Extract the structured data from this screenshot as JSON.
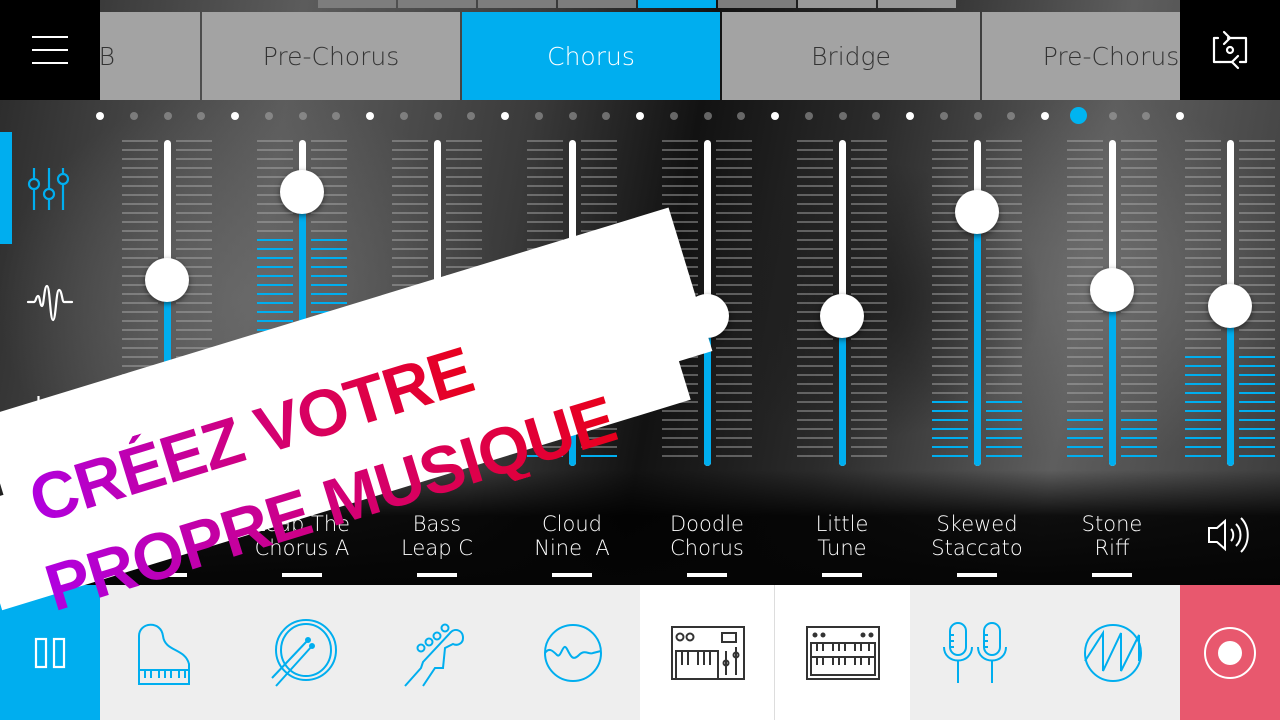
{
  "header": {
    "menu_icon": "hamburger-menu-icon",
    "loop_icon": "loop-swap-icon",
    "mini_segments": {
      "count": 8,
      "active_index": 4
    },
    "sections": [
      {
        "label": "Verse B",
        "active": false
      },
      {
        "label": "Pre-Chorus",
        "active": false
      },
      {
        "label": "Chorus",
        "active": true
      },
      {
        "label": "Bridge",
        "active": false
      },
      {
        "label": "Pre-Chorus",
        "active": false
      }
    ]
  },
  "sidebar": {
    "items": [
      {
        "icon": "mixer-sliders-icon",
        "active": true
      },
      {
        "icon": "waveform-icon",
        "active": false
      },
      {
        "icon": "music-notes-icon",
        "active": false
      }
    ]
  },
  "beat_dots": {
    "count": 33,
    "major_every": 4,
    "current_index": 29
  },
  "mixer": {
    "channels": [
      {
        "label_line1": "",
        "label_line2": "",
        "fader": 0.57,
        "meter_level": 0.0
      },
      {
        "label_line1": "Leap The",
        "label_line2": "Chorus A",
        "fader": 0.84,
        "meter_level": 0.72
      },
      {
        "label_line1": "Bass",
        "label_line2": "Leap C",
        "fader": 0.47,
        "meter_level": 0.0
      },
      {
        "label_line1": "Cloud",
        "label_line2": "Nine  A",
        "fader": 0.51,
        "meter_level": 0.06
      },
      {
        "label_line1": "Doodle",
        "label_line2": "Chorus",
        "fader": 0.46,
        "meter_level": 0.0
      },
      {
        "label_line1": "Little",
        "label_line2": "Tune",
        "fader": 0.46,
        "meter_level": 0.0
      },
      {
        "label_line1": "Skewed",
        "label_line2": "Staccato",
        "fader": 0.78,
        "meter_level": 0.2
      },
      {
        "label_line1": "Stone",
        "label_line2": "Riff",
        "fader": 0.54,
        "meter_level": 0.17
      }
    ],
    "master": {
      "fader": 0.49,
      "meter_level": 0.36,
      "icon": "speaker-volume-icon"
    }
  },
  "toolbar": {
    "play_state_icon": "pause-icon",
    "instruments": [
      {
        "icon": "grand-piano-icon",
        "selected": false
      },
      {
        "icon": "drum-icon",
        "selected": false
      },
      {
        "icon": "bass-guitar-icon",
        "selected": false
      },
      {
        "icon": "synth-wave-icon",
        "selected": false
      },
      {
        "icon": "synth-keyboard-icon",
        "selected": true
      },
      {
        "icon": "organ-keyboard-icon",
        "selected": true
      },
      {
        "icon": "microphones-icon",
        "selected": false
      },
      {
        "icon": "sawtooth-wave-icon",
        "selected": false
      }
    ],
    "record_icon": "record-icon"
  },
  "promo": {
    "line1": "CRÉEZ VOTRE",
    "line2": "PROPRE MUSIQUE"
  },
  "colors": {
    "accent": "#00aeef",
    "record": "#e8586e",
    "tab_inactive": "#a3a3a3",
    "toolbar_bg": "#eeeeee",
    "promo_gradient_start": "#b000e0",
    "promo_gradient_end": "#e8001c"
  }
}
